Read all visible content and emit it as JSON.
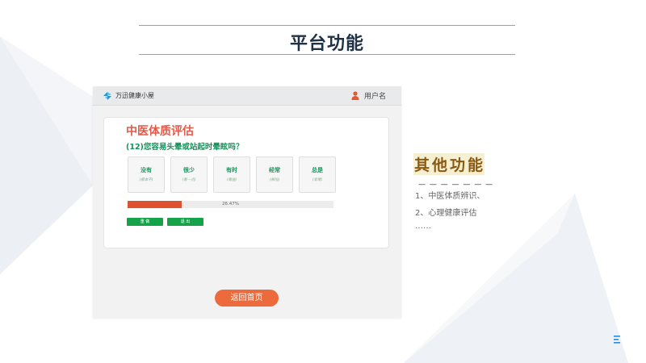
{
  "slide": {
    "title": "平台功能"
  },
  "app": {
    "name": "万迅健康小屋",
    "user_label": "用户名",
    "card_title": "中医体质评估",
    "question": "(12)您容易头晕或站起时晕眩吗？",
    "options": [
      {
        "label": "没有",
        "sub": "(根本不)"
      },
      {
        "label": "很少",
        "sub": "(有一点)"
      },
      {
        "label": "有时",
        "sub": "(有些)"
      },
      {
        "label": "经常",
        "sub": "(相当)"
      },
      {
        "label": "总是",
        "sub": "(非常)"
      }
    ],
    "progress": {
      "value": 0.2647,
      "text": "26.47%"
    },
    "buttons": {
      "redo": "重 做",
      "exit": "退 出"
    },
    "home_button": "返回首页"
  },
  "other": {
    "title_chars": [
      "其",
      "他",
      "功",
      "能"
    ],
    "dashes": "— — — — — — —",
    "features": [
      "1、中医体质辨识、",
      "2、心理健康评估",
      "……"
    ]
  },
  "colors": {
    "accent_red": "#e25a4a",
    "accent_green": "#15925a",
    "button_green": "#15a34a",
    "progress_fill": "#e0522f",
    "home_button": "#ec6a3b",
    "title_dark": "#1f3146",
    "other_title": "#8a5a12"
  },
  "icons": {
    "logo": "brand-logo-icon",
    "user": "user-icon",
    "corner": "corner-mark-icon"
  }
}
